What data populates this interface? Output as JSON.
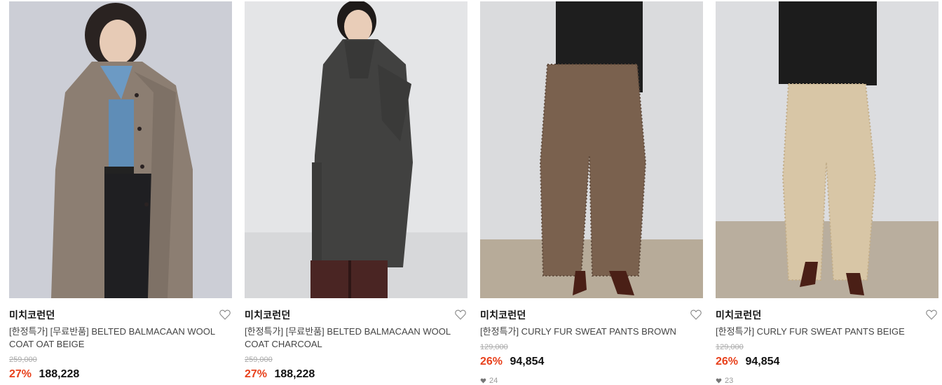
{
  "products": [
    {
      "brand": "미치코런던",
      "title": "[한정특가] [무료반품] BELTED BALMACAAN WOOL COAT OAT BEIGE",
      "original_price": "259,000",
      "discount": "27%",
      "price": "188,228",
      "likes": null,
      "image_colors": {
        "bg": "#c7c9d1",
        "main": "#8a7c70",
        "accent": "#5b8ab4"
      }
    },
    {
      "brand": "미치코런던",
      "title": "[한정특가] [무료반품] BELTED BALMACAAN WOOL COAT CHARCOAL",
      "original_price": "259,000",
      "discount": "27%",
      "price": "188,228",
      "likes": null,
      "image_colors": {
        "bg": "#e3e4e6",
        "main": "#3f3f3d",
        "accent": "#4a2523"
      }
    },
    {
      "brand": "미치코런던",
      "title": "[한정특가] CURLY FUR SWEAT PANTS BROWN",
      "original_price": "129,000",
      "discount": "26%",
      "price": "94,854",
      "likes": "24",
      "image_colors": {
        "bg": "#d9dadc",
        "main": "#7d6451",
        "accent": "#1d1d1d"
      }
    },
    {
      "brand": "미치코런던",
      "title": "[한정특가] CURLY FUR SWEAT PANTS BEIGE",
      "original_price": "129,000",
      "discount": "26%",
      "price": "94,854",
      "likes": "23",
      "image_colors": {
        "bg": "#dcdde0",
        "main": "#d9c7a7",
        "accent": "#1d1d1d"
      }
    }
  ],
  "colors": {
    "discount": "#e8411c",
    "strike": "#aaaaaa",
    "text": "#222222"
  }
}
